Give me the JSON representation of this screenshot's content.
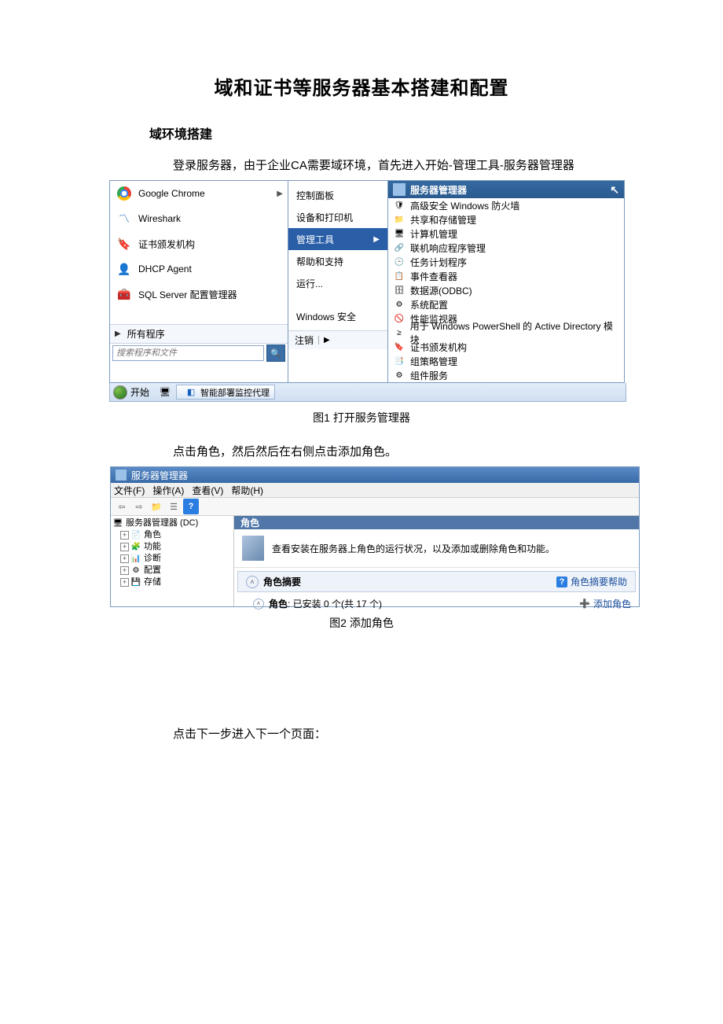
{
  "doc": {
    "title": "域和证书等服务器基本搭建和配置",
    "section1": "域环境搭建",
    "para1": "登录服务器，由于企业CA需要域环境，首先进入开始-管理工具-服务器管理器",
    "figcap1": "图1  打开服务管理器",
    "para2": "点击角色，然后然后在右侧点击添加角色。",
    "figcap2": "图2  添加角色",
    "para3": "点击下一步进入下一个页面："
  },
  "startmenu": {
    "programs": [
      {
        "label": "Google Chrome",
        "icon": "chrome",
        "hasSub": true
      },
      {
        "label": "Wireshark",
        "icon": "wireshark",
        "hasSub": false
      },
      {
        "label": "证书颁发机构",
        "icon": "ca",
        "hasSub": false
      },
      {
        "label": "DHCP Agent",
        "icon": "dhcp",
        "hasSub": false
      },
      {
        "label": "SQL Server 配置管理器",
        "icon": "sql",
        "hasSub": false
      }
    ],
    "allprograms": "所有程序",
    "search_placeholder": "搜索程序和文件",
    "mid": [
      {
        "label": "控制面板"
      },
      {
        "label": "设备和打印机"
      },
      {
        "label": "管理工具",
        "highlight": true,
        "hasSub": true
      },
      {
        "label": "帮助和支持"
      },
      {
        "label": "运行..."
      },
      {
        "label": "Windows 安全"
      }
    ],
    "logoff": "注销",
    "tools_header": "服务器管理器",
    "tools": [
      "高级安全 Windows 防火墙",
      "共享和存储管理",
      "计算机管理",
      "联机响应程序管理",
      "任务计划程序",
      "事件查看器",
      "数据源(ODBC)",
      "系统配置",
      "性能监视器",
      "用于 Windows PowerShell 的 Active Directory 模块",
      "证书颁发机构",
      "组策略管理",
      "组件服务"
    ]
  },
  "taskbar": {
    "start": "开始",
    "app": "智能部署监控代理"
  },
  "servermgr": {
    "title": "服务器管理器",
    "menus": [
      "文件(F)",
      "操作(A)",
      "查看(V)",
      "帮助(H)"
    ],
    "tree_root": "服务器管理器 (DC)",
    "tree": [
      "角色",
      "功能",
      "诊断",
      "配置",
      "存储"
    ],
    "panel_header": "角色",
    "panel_desc": "查看安装在服务器上角色的运行状况，以及添加或删除角色和功能。",
    "summary_label": "角色摘要",
    "summary_help": "角色摘要帮助",
    "roles_line_bold": "角色",
    "roles_line_rest": ": 已安装 0 个(共 17 个)",
    "add_role": "添加角色"
  }
}
